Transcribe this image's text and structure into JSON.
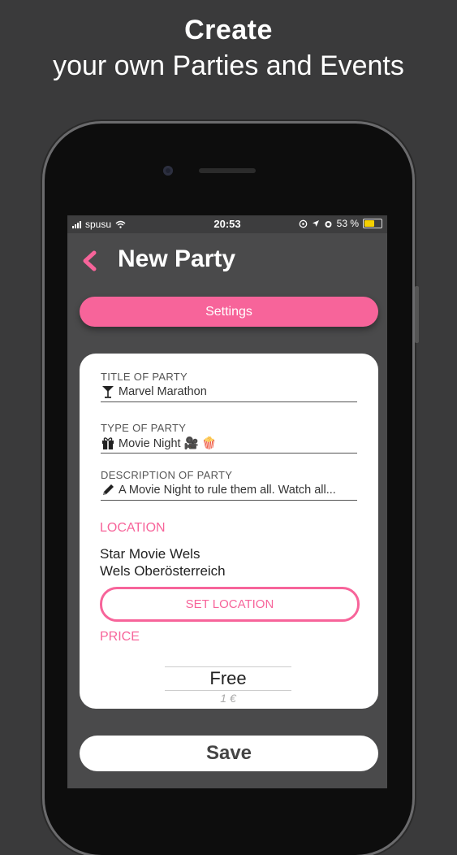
{
  "promo": {
    "title": "Create",
    "subtitle": "your own Parties and Events"
  },
  "status_bar": {
    "carrier": "spusu",
    "time": "20:53",
    "battery": "53 %"
  },
  "nav": {
    "title": "New Party"
  },
  "settings_label": "Settings",
  "form": {
    "title_field": {
      "label": "TITLE OF PARTY",
      "value": "Marvel Marathon",
      "icon": "cocktail-glass-icon"
    },
    "type_field": {
      "label": "TYPE OF PARTY",
      "value": "Movie Night 🎥 🍿",
      "icon": "gift-icon"
    },
    "description_field": {
      "label": "DESCRIPTION OF PARTY",
      "value": "A Movie Night to rule them all. Watch all...",
      "icon": "pencil-icon"
    },
    "location": {
      "header": "LOCATION",
      "line1": "Star Movie Wels",
      "line2": "Wels Oberösterreich",
      "button_label": "SET LOCATION"
    },
    "price": {
      "header": "PRICE",
      "selected": "Free",
      "next_option": "1 €"
    }
  },
  "save_label": "Save",
  "colors": {
    "accent": "#f7649a",
    "background": "#3a3a3b",
    "screen": "#4a4a4b"
  }
}
